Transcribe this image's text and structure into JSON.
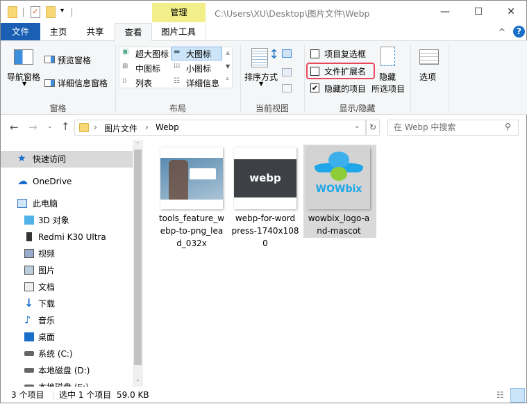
{
  "title_bar": {
    "context_tab": "管理",
    "path": "C:\\Users\\XU\\Desktop\\图片文件\\Webp",
    "minimize": "—",
    "maximize": "☐",
    "close": "✕"
  },
  "tabs": {
    "file": "文件",
    "home": "主页",
    "share": "共享",
    "view": "查看",
    "picture_tools": "图片工具",
    "collapse": "^",
    "help": "?"
  },
  "ribbon": {
    "panes": {
      "nav_pane": "导航窗格",
      "preview_pane": "预览窗格",
      "details_pane": "详细信息窗格",
      "group": "窗格"
    },
    "layout": {
      "extra_large": "超大图标",
      "large": "大图标",
      "medium": "中图标",
      "small": "小图标",
      "list": "列表",
      "details": "详细信息",
      "group": "布局"
    },
    "current_view": {
      "sort_by": "排序方式",
      "group": "当前视图"
    },
    "show_hide": {
      "item_checkboxes": "项目复选框",
      "file_extensions": "文件扩展名",
      "hidden_items": "隐藏的项目",
      "hide_selected_1": "隐藏",
      "hide_selected_2": "所选项目",
      "group": "显示/隐藏",
      "item_checkboxes_checked": false,
      "file_extensions_checked": false,
      "hidden_items_checked": true
    },
    "options": {
      "label": "选项"
    }
  },
  "address": {
    "crumbs": [
      "图片文件",
      "Webp"
    ],
    "search_placeholder": "在 Webp 中搜索"
  },
  "nav": [
    {
      "label": "快速访问",
      "icon": "star-icon"
    },
    {
      "label": "OneDrive",
      "icon": "cloud-icon"
    },
    {
      "label": "此电脑",
      "icon": "computer-icon"
    },
    {
      "label": "3D 对象",
      "icon": "cube-icon"
    },
    {
      "label": "Redmi K30 Ultra",
      "icon": "phone-icon"
    },
    {
      "label": "视频",
      "icon": "video-icon"
    },
    {
      "label": "图片",
      "icon": "picture-icon"
    },
    {
      "label": "文档",
      "icon": "document-icon"
    },
    {
      "label": "下载",
      "icon": "download-icon"
    },
    {
      "label": "音乐",
      "icon": "music-icon"
    },
    {
      "label": "桌面",
      "icon": "desktop-icon"
    },
    {
      "label": "系统 (C:)",
      "icon": "drive-icon"
    },
    {
      "label": "本地磁盘 (D:)",
      "icon": "drive-icon"
    },
    {
      "label": "本地磁盘 (E:)",
      "icon": "drive-icon"
    }
  ],
  "files": [
    {
      "lines": [
        "tools_feature_w",
        "ebp-to-png_lea",
        "d_032x"
      ]
    },
    {
      "lines": [
        "webp-for-word",
        "press-1740x108",
        "0"
      ],
      "logo": "webp"
    },
    {
      "lines": [
        "wowbix_logo-a",
        "nd-mascot"
      ],
      "logo": "WOWbix",
      "selected": true
    }
  ],
  "status": {
    "count": "3 个项目",
    "selected": "选中 1 个项目",
    "size": "59.0 KB"
  },
  "colors": {
    "file_tab": "#1a5fb4",
    "highlight_red": "#e8485a",
    "context_yellow": "#f2ef8a",
    "selected_bg": "#d9d9d9"
  }
}
